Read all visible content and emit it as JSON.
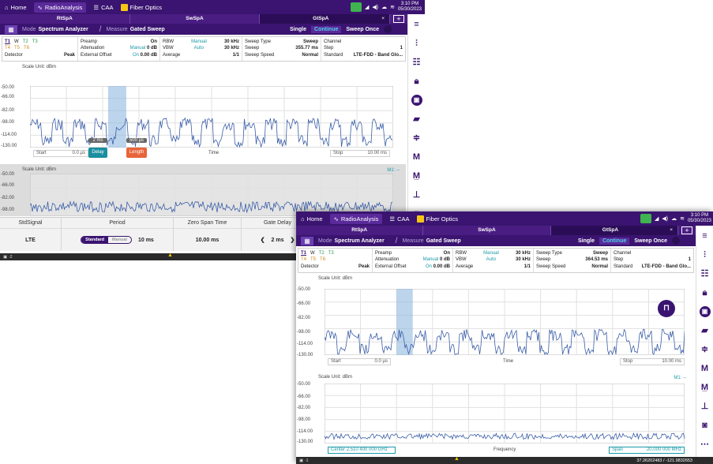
{
  "w1": {
    "top_tabs": [
      {
        "label": "Home",
        "icon": "home-icon"
      },
      {
        "label": "RadioAnalysis",
        "icon": "radio-analysis-icon"
      },
      {
        "label": "CAA",
        "icon": "caa-icon"
      },
      {
        "label": "Fiber Optics",
        "icon": "fiber-optics-icon"
      }
    ],
    "clock": {
      "time": "3:10 PM",
      "date": "05/30/2023"
    },
    "app_tabs": [
      "RtSpA",
      "SwSpA",
      "GtSpA"
    ],
    "mode_label": "Mode",
    "mode": "Spectrum Analyzer",
    "measure_label": "Measure",
    "measure": "Gated Sweep",
    "sweep_buttons": {
      "single": "Single",
      "continue": "Continue",
      "once": "Sweep Once"
    },
    "traces": {
      "t1": "T1",
      "w": "W",
      "t2": "T2",
      "t3": "T3",
      "t4": "T4",
      "t5": "T5",
      "t6": "T6",
      "detector_label": "Detector",
      "detector": "Peak"
    },
    "p1": {
      "preamp_label": "Preamp",
      "preamp": "On",
      "atten_label": "Attenuation",
      "atten_mode": "Manual",
      "atten": "0 dB",
      "offset_label": "External Offset",
      "offset_mode": "On",
      "offset": "0.00 dB"
    },
    "p2": {
      "rbw_label": "RBW",
      "rbw_mode": "Manual",
      "rbw": "30 kHz",
      "vbw_label": "VBW",
      "vbw_mode": "Auto",
      "vbw": "30 kHz",
      "avg_label": "Average",
      "avg": "1/1"
    },
    "p3": {
      "type_label": "Sweep Type",
      "type": "Sweep",
      "sweep_label": "Sweep",
      "sweep": "355.77 ms",
      "speed_label": "Sweep Speed",
      "speed": "Normal"
    },
    "p4": {
      "channel_label": "Channel",
      "step_label": "Step",
      "step": "1",
      "std_label": "Standard",
      "std": "LTE-FDD - Band Glo..."
    },
    "plot1": {
      "scale": "Scale Unit: dBm",
      "y": [
        "-50.00",
        "-66.00",
        "-82.00",
        "-98.00",
        "-114.00",
        "-130.00"
      ],
      "start_label": "Start",
      "start": "0.0 μs",
      "center_label": "Time",
      "stop_label": "Stop",
      "stop": "10.00 ms",
      "delay_val": "2 ms",
      "delay_label": "Delay",
      "length_val": "500 μs",
      "length_label": "Length"
    },
    "plot2": {
      "scale": "Scale Unit: dBm",
      "y": [
        "-50.00",
        "-66.00",
        "-82.00",
        "-98.00"
      ],
      "marker": "M1: --"
    },
    "bottom": {
      "std_h": "StdSignal",
      "std_v": "LTE",
      "period_h": "Period",
      "period_on": "Standard",
      "period_off": "Manual",
      "period_v": "10 ms",
      "zst_h": "Zero Span Time",
      "zst_v": "10.00 ms",
      "gd_h": "Gate Delay",
      "gd_v": "2 ms"
    },
    "statusbar": "▣ ·2"
  },
  "w2": {
    "top_tabs": [
      {
        "label": "Home",
        "icon": "home-icon"
      },
      {
        "label": "RadioAnalysis",
        "icon": "radio-analysis-icon"
      },
      {
        "label": "CAA",
        "icon": "caa-icon"
      },
      {
        "label": "Fiber Optics",
        "icon": "fiber-optics-icon"
      }
    ],
    "clock": {
      "time": "3:10 PM",
      "date": "05/30/2023"
    },
    "app_tabs": [
      "RtSpA",
      "SwSpA",
      "GtSpA"
    ],
    "mode_label": "Mode",
    "mode": "Spectrum Analyzer",
    "measure_label": "Measure",
    "measure": "Gated Sweep",
    "sweep_buttons": {
      "single": "Single",
      "continue": "Continue",
      "once": "Sweep Once"
    },
    "traces": {
      "t1": "T1",
      "w": "W",
      "t2": "T2",
      "t3": "T3",
      "t4": "T4",
      "t5": "T5",
      "t6": "T6",
      "detector_label": "Detector",
      "detector": "Peak"
    },
    "p1": {
      "preamp_label": "Preamp",
      "preamp": "On",
      "atten_label": "Attenuation",
      "atten_mode": "Manual",
      "atten": "0 dB",
      "offset_label": "External Offset",
      "offset_mode": "On",
      "offset": "0.00 dB"
    },
    "p2": {
      "rbw_label": "RBW",
      "rbw_mode": "Manual",
      "rbw": "30 kHz",
      "vbw_label": "VBW",
      "vbw_mode": "Auto",
      "vbw": "30 kHz",
      "avg_label": "Average",
      "avg": "1/1"
    },
    "p3": {
      "type_label": "Sweep Type",
      "type": "Sweep",
      "sweep_label": "Sweep",
      "sweep": "364.53 ms",
      "speed_label": "Sweep Speed",
      "speed": "Normal"
    },
    "p4": {
      "channel_label": "Channel",
      "step_label": "Step",
      "step": "1",
      "std_label": "Standard",
      "std": "LTE-FDD - Band Glo..."
    },
    "plot1": {
      "scale": "Scale Unit: dBm",
      "y": [
        "-50.00",
        "-66.00",
        "-82.00",
        "-98.00",
        "-114.00",
        "-130.00"
      ],
      "start_label": "Start",
      "start": "0.0 μs",
      "center_label": "Time",
      "stop_label": "Stop",
      "stop": "10.00 ms"
    },
    "plot2": {
      "scale": "Scale Unit: dBm",
      "y": [
        "-50.00",
        "-66.00",
        "-82.00",
        "-98.00",
        "-114.00",
        "-130.00"
      ],
      "marker": "M1: --",
      "center_label": "Center",
      "center": "2.510 400 000 GHz",
      "freq_label": "Frequency",
      "span_label": "Span",
      "span": "20.000 000 MHz"
    },
    "statusbar": "▣ ·1",
    "gps": "37.26202483 / -121.9832653"
  },
  "colors": {
    "purple": "#3a1470",
    "teal": "#1a9aa8",
    "trace": "#3b5ea8",
    "gate": "#8fb8e0",
    "delay": "#1a8fa0",
    "length": "#e8643a"
  }
}
